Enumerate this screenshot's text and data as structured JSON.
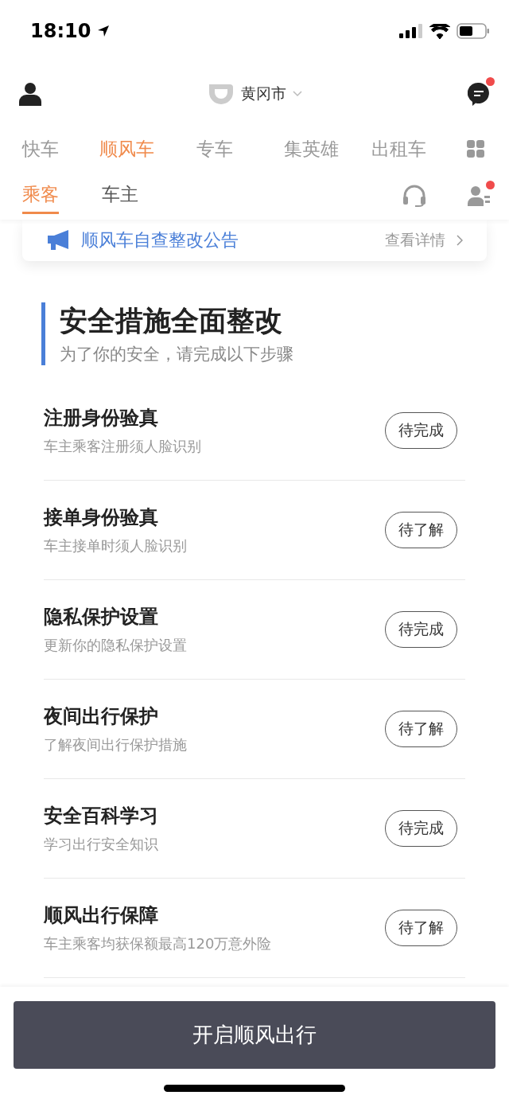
{
  "status_bar": {
    "time": "18:10"
  },
  "header": {
    "city": "黄冈市",
    "messages_badge": true
  },
  "service_tabs": [
    {
      "label": "快车",
      "selected": false
    },
    {
      "label": "顺风车",
      "selected": true
    },
    {
      "label": "专车",
      "selected": false
    },
    {
      "label": "集英雄",
      "selected": false
    },
    {
      "label": "出租车",
      "selected": false
    }
  ],
  "role_tabs": [
    {
      "label": "乘客",
      "selected": true
    },
    {
      "label": "车主",
      "selected": false
    }
  ],
  "driver_badge": true,
  "notice": {
    "text": "顺风车自查整改公告",
    "link": "查看详情"
  },
  "section": {
    "title": "安全措施全面整改",
    "subtitle": "为了你的安全，请完成以下步骤"
  },
  "steps": [
    {
      "title": "注册身份验真",
      "description": "车主乘客注册须人脸识别",
      "status": "待完成"
    },
    {
      "title": "接单身份验真",
      "description": "车主接单时须人脸识别",
      "status": "待了解"
    },
    {
      "title": "隐私保护设置",
      "description": "更新你的隐私保护设置",
      "status": "待完成"
    },
    {
      "title": "夜间出行保护",
      "description": "了解夜间出行保护措施",
      "status": "待了解"
    },
    {
      "title": "安全百科学习",
      "description": "学习出行安全知识",
      "status": "待完成"
    },
    {
      "title": "顺风出行保障",
      "description": "车主乘客均获保额最高120万意外险",
      "status": "待了解"
    }
  ],
  "primary_button": "开启顺风出行"
}
